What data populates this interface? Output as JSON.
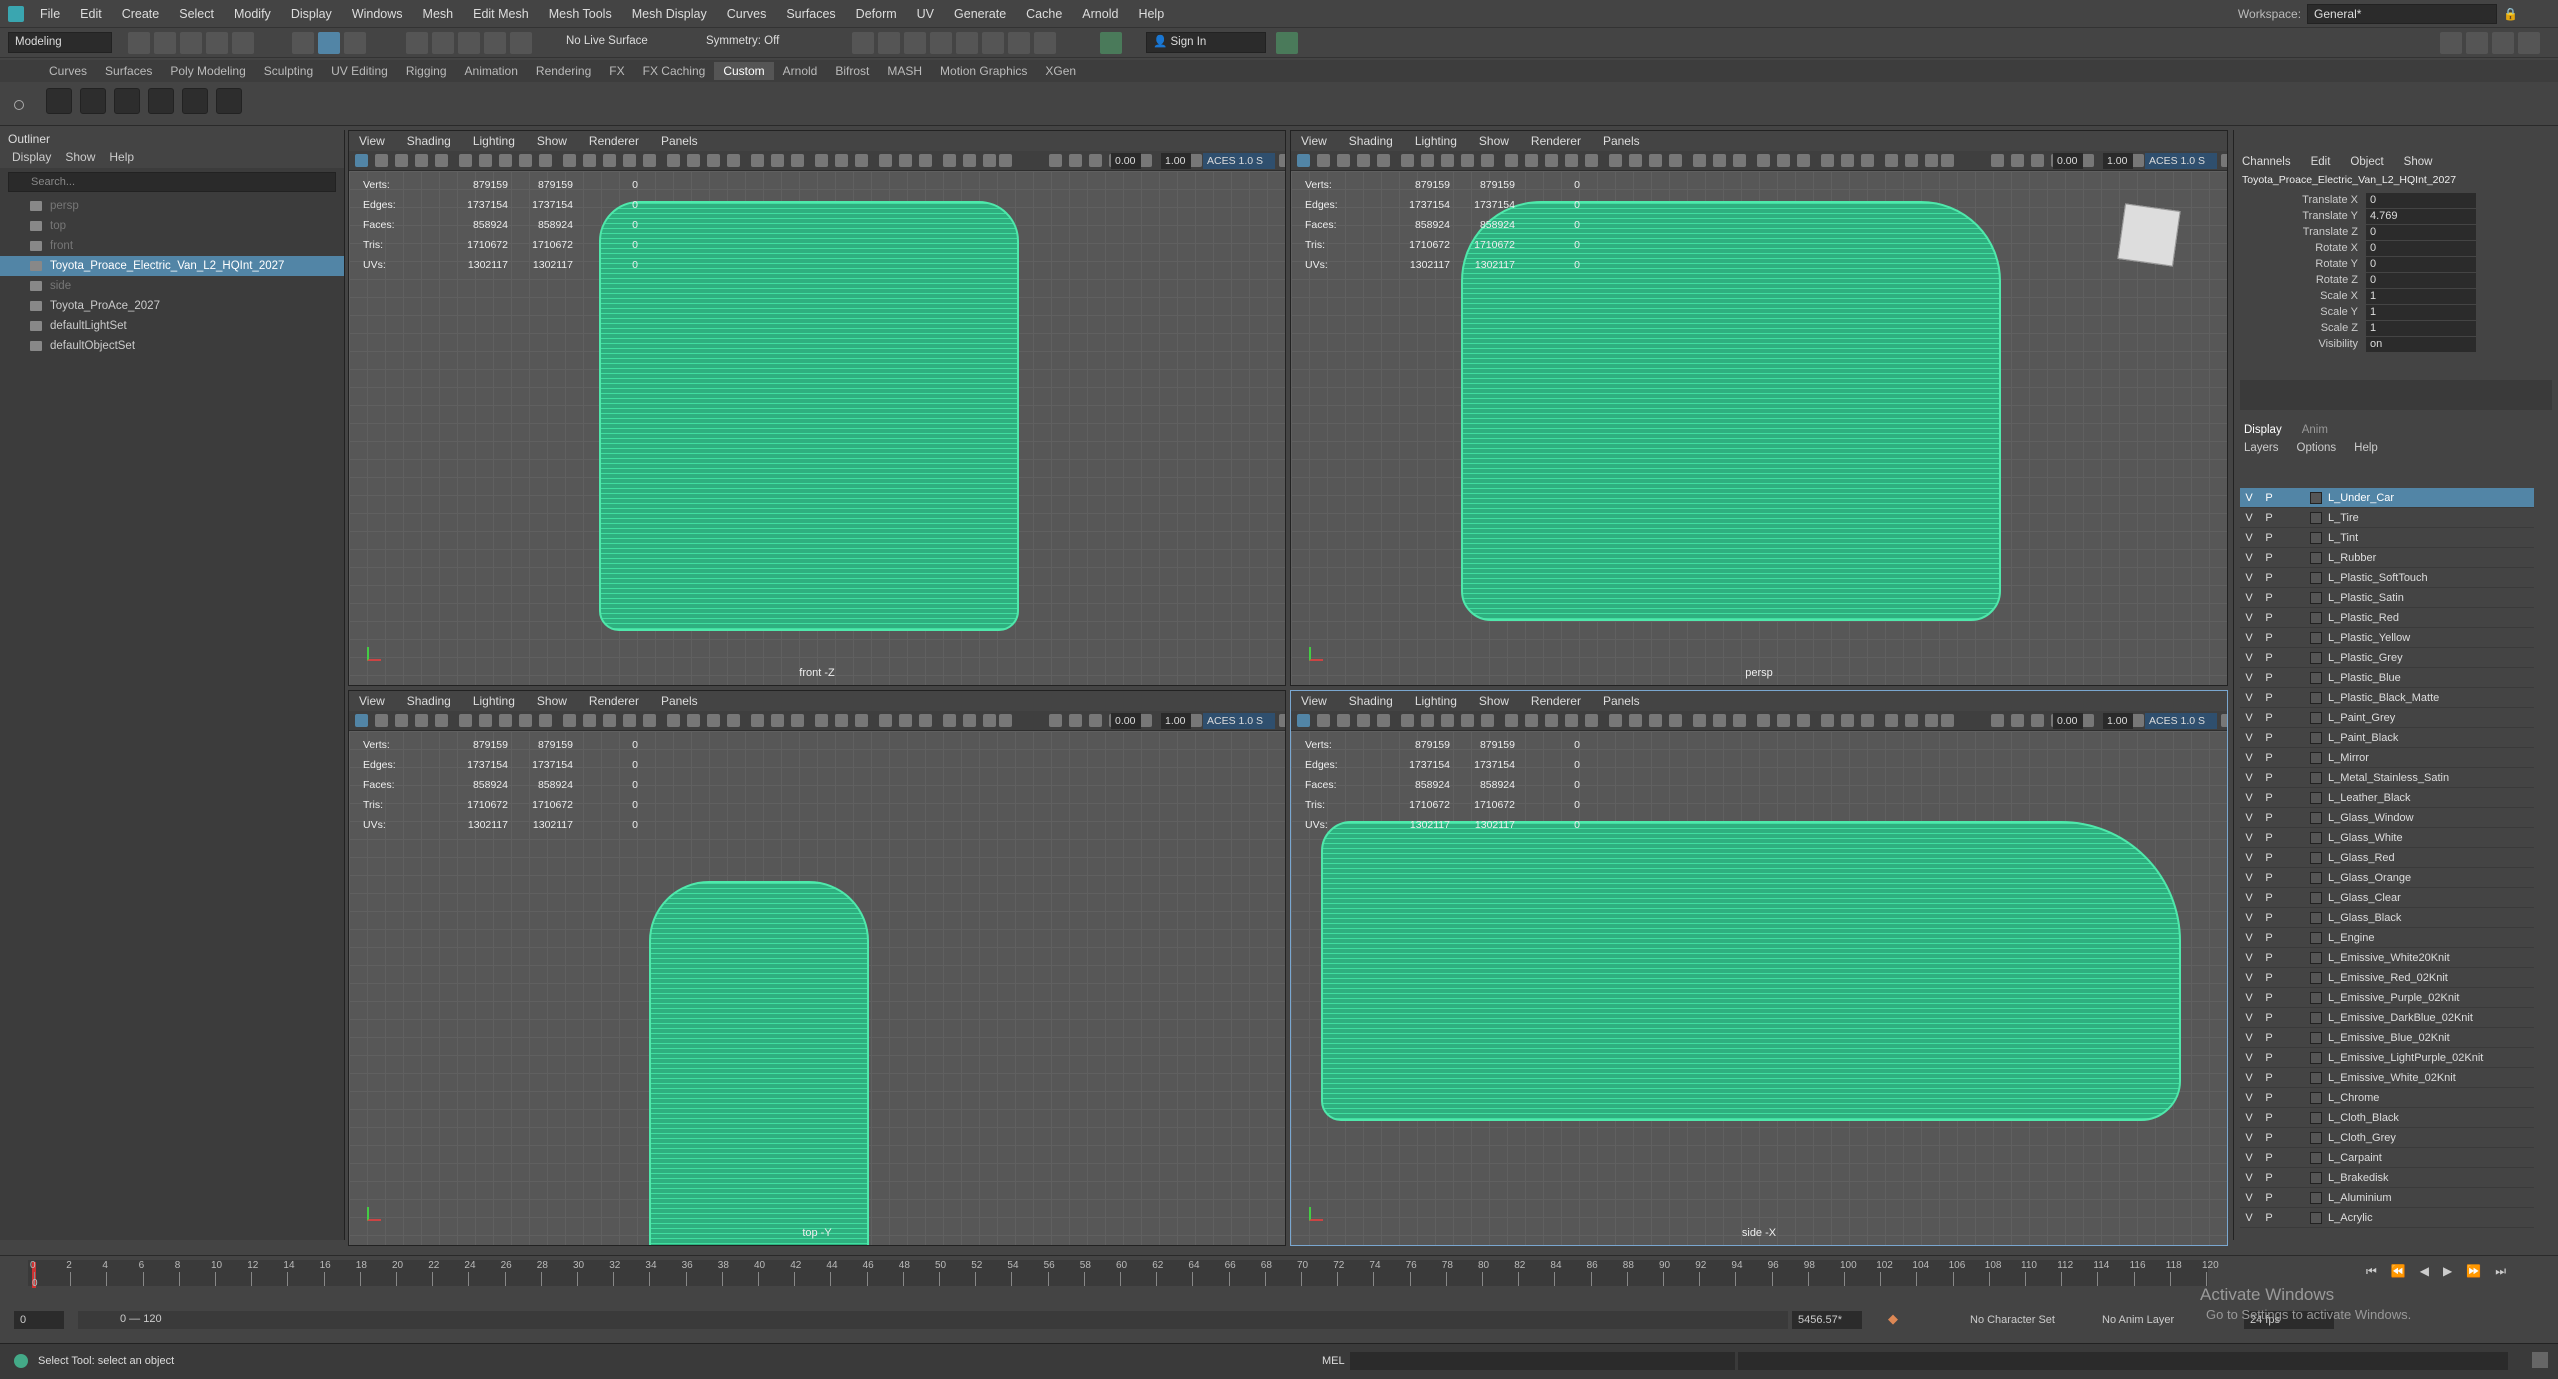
{
  "menubar": {
    "items": [
      "File",
      "Edit",
      "Create",
      "Select",
      "Modify",
      "Display",
      "Windows",
      "Mesh",
      "Edit Mesh",
      "Mesh Tools",
      "Mesh Display",
      "Curves",
      "Surfaces",
      "Deform",
      "UV",
      "Generate",
      "Cache",
      "Arnold",
      "Help"
    ],
    "workspace_label": "Workspace:",
    "workspace_value": "General*"
  },
  "statusline": {
    "mode": "Modeling",
    "live_surface": "No Live Surface",
    "symmetry": "Symmetry: Off",
    "sign_in": "Sign In"
  },
  "shelf": {
    "tabs": [
      "Curves",
      "Surfaces",
      "Poly Modeling",
      "Sculpting",
      "UV Editing",
      "Rigging",
      "Animation",
      "Rendering",
      "FX",
      "FX Caching",
      "Custom",
      "Arnold",
      "Bifrost",
      "MASH",
      "Motion Graphics",
      "XGen"
    ],
    "active_tab": "Custom"
  },
  "outliner": {
    "title": "Outliner",
    "menu": [
      "Display",
      "Show",
      "Help"
    ],
    "search_placeholder": "Search...",
    "items": [
      {
        "label": "persp",
        "dim": true
      },
      {
        "label": "top",
        "dim": true
      },
      {
        "label": "front",
        "dim": true
      },
      {
        "label": "Toyota_Proace_Electric_Van_L2_HQInt_2027",
        "selected": true
      },
      {
        "label": "side",
        "dim": true
      },
      {
        "label": "Toyota_ProAce_2027"
      },
      {
        "label": "defaultLightSet"
      },
      {
        "label": "defaultObjectSet"
      }
    ]
  },
  "viewports": [
    {
      "name": "front -Z",
      "menu": [
        "View",
        "Shading",
        "Lighting",
        "Show",
        "Renderer",
        "Panels"
      ]
    },
    {
      "name": "persp",
      "menu": [
        "View",
        "Shading",
        "Lighting",
        "Show",
        "Renderer",
        "Panels"
      ]
    },
    {
      "name": "top -Y",
      "menu": [
        "View",
        "Shading",
        "Lighting",
        "Show",
        "Renderer",
        "Panels"
      ]
    },
    {
      "name": "side -X",
      "menu": [
        "View",
        "Shading",
        "Lighting",
        "Show",
        "Renderer",
        "Panels"
      ]
    }
  ],
  "viewport_toolbar": {
    "value1": "0.00",
    "value2": "1.00",
    "colorspace": "ACES 1.0 S"
  },
  "stats": [
    {
      "label": "Verts:",
      "a": "879159",
      "b": "879159",
      "c": "0"
    },
    {
      "label": "Edges:",
      "a": "1737154",
      "b": "1737154",
      "c": "0"
    },
    {
      "label": "Faces:",
      "a": "858924",
      "b": "858924",
      "c": "0"
    },
    {
      "label": "Tris:",
      "a": "1710672",
      "b": "1710672",
      "c": "0"
    },
    {
      "label": "UVs:",
      "a": "1302117",
      "b": "1302117",
      "c": "0"
    }
  ],
  "channelbox": {
    "menu": [
      "Channels",
      "Edit",
      "Object",
      "Show"
    ],
    "object": "Toyota_Proace_Electric_Van_L2_HQInt_2027",
    "attrs": [
      {
        "label": "Translate X",
        "value": "0"
      },
      {
        "label": "Translate Y",
        "value": "4.769"
      },
      {
        "label": "Translate Z",
        "value": "0"
      },
      {
        "label": "Rotate X",
        "value": "0"
      },
      {
        "label": "Rotate Y",
        "value": "0"
      },
      {
        "label": "Rotate Z",
        "value": "0"
      },
      {
        "label": "Scale X",
        "value": "1"
      },
      {
        "label": "Scale Y",
        "value": "1"
      },
      {
        "label": "Scale Z",
        "value": "1"
      },
      {
        "label": "Visibility",
        "value": "on"
      }
    ],
    "layer_tabs": [
      "Display",
      "Anim"
    ],
    "layer_menu": [
      "Layers",
      "Options",
      "Help"
    ],
    "layers": [
      "L_Under_Car",
      "L_Tire",
      "L_Tint",
      "L_Rubber",
      "L_Plastic_SoftTouch",
      "L_Plastic_Satin",
      "L_Plastic_Red",
      "L_Plastic_Yellow",
      "L_Plastic_Grey",
      "L_Plastic_Blue",
      "L_Plastic_Black_Matte",
      "L_Paint_Grey",
      "L_Paint_Black",
      "L_Mirror",
      "L_Metal_Stainless_Satin",
      "L_Leather_Black",
      "L_Glass_Window",
      "L_Glass_White",
      "L_Glass_Red",
      "L_Glass_Orange",
      "L_Glass_Clear",
      "L_Glass_Black",
      "L_Engine",
      "L_Emissive_White20Knit",
      "L_Emissive_Red_02Knit",
      "L_Emissive_Purple_02Knit",
      "L_Emissive_DarkBlue_02Knit",
      "L_Emissive_Blue_02Knit",
      "L_Emissive_LightPurple_02Knit",
      "L_Emissive_White_02Knit",
      "L_Chrome",
      "L_Cloth_Black",
      "L_Cloth_Grey",
      "L_Carpaint",
      "L_Brakedisk",
      "L_Aluminium",
      "L_Acrylic"
    ],
    "layer_v": "V",
    "layer_p": "P"
  },
  "timeslider": {
    "ticks": [
      "0",
      "2",
      "4",
      "6",
      "8",
      "10",
      "12",
      "14",
      "16",
      "18",
      "20",
      "22",
      "24",
      "26",
      "28",
      "30",
      "32",
      "34",
      "36",
      "38",
      "40",
      "42",
      "44",
      "46",
      "48",
      "50",
      "52",
      "54",
      "56",
      "58",
      "60",
      "62",
      "64",
      "66",
      "68",
      "70",
      "72",
      "74",
      "76",
      "78",
      "80",
      "82",
      "84",
      "86",
      "88",
      "90",
      "92",
      "94",
      "96",
      "98",
      "100",
      "102",
      "104",
      "106",
      "108",
      "110",
      "112",
      "114",
      "116",
      "118",
      "120"
    ],
    "current": "0"
  },
  "range": {
    "start": "0",
    "range_label": "0 — 120",
    "end_value": "5456.57*",
    "character_set": "No Character Set",
    "anim_layer": "No Anim Layer",
    "fps": "24 fps"
  },
  "cmdline": {
    "help": "Select Tool: select an object",
    "lang": "MEL"
  },
  "watermark": {
    "line1": "Activate Windows",
    "line2": "Go to Settings to activate Windows."
  }
}
